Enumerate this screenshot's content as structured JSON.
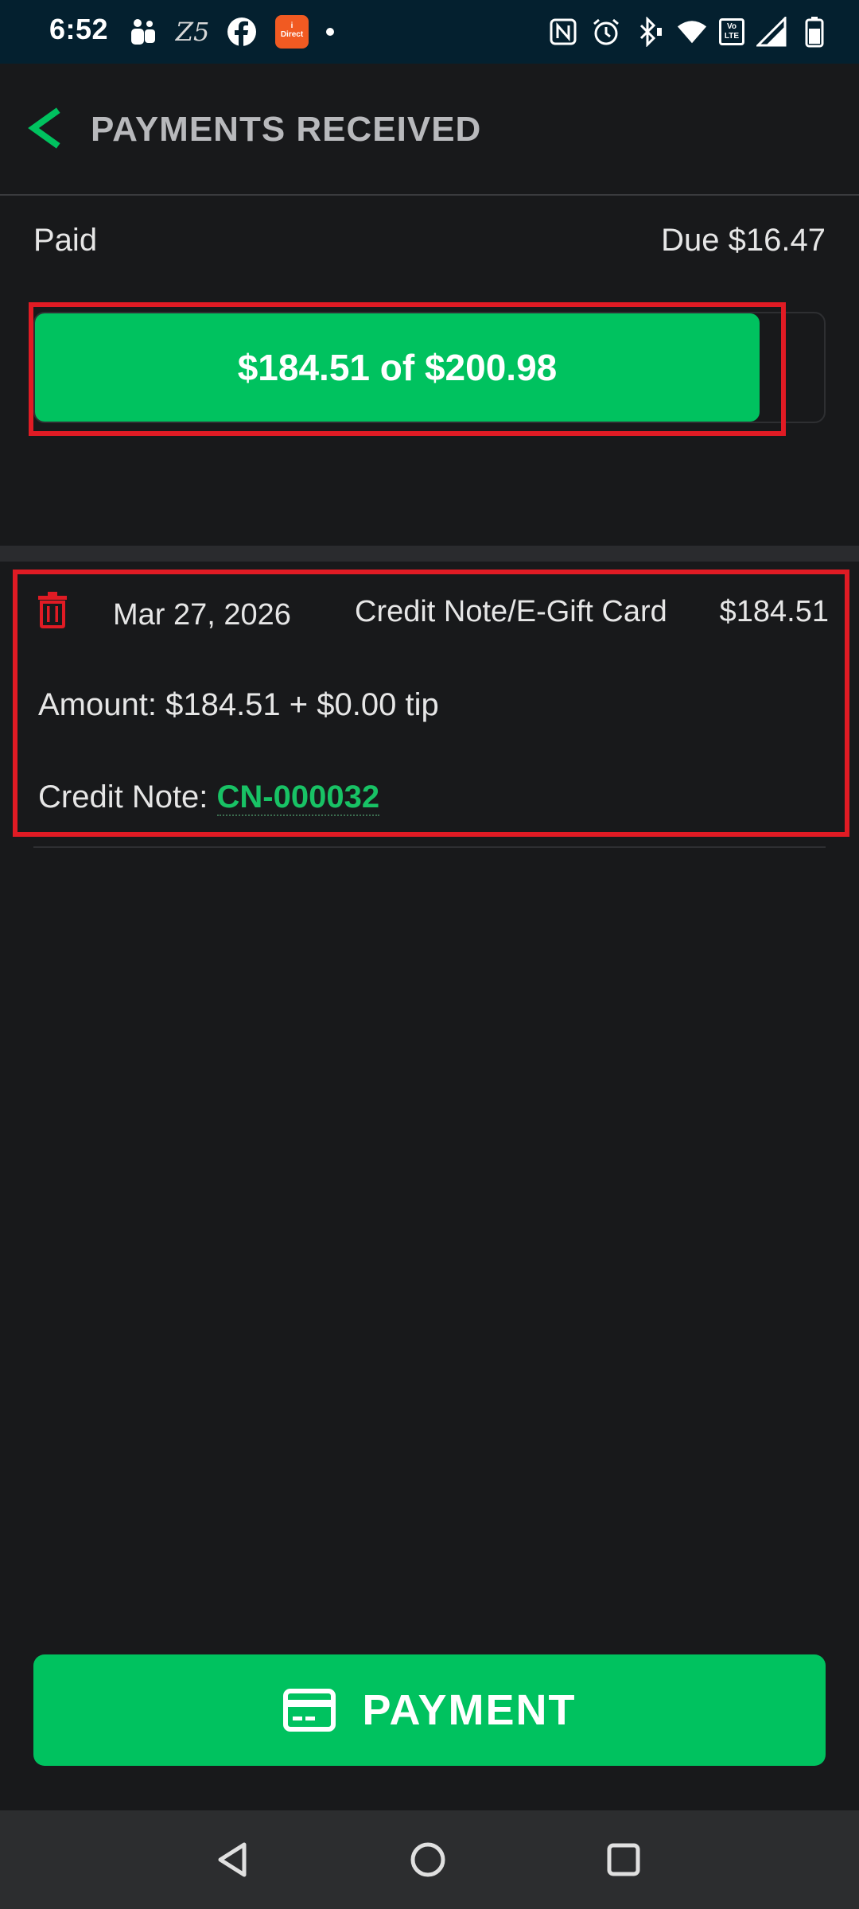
{
  "status_bar": {
    "time": "6:52",
    "left_icons": [
      "teams-icon",
      "zee5-icon",
      "facebook-icon",
      "icici-direct-icon",
      "notification-dot-icon"
    ],
    "zee5_text": "Z5",
    "right_icons": [
      "nfc-icon",
      "alarm-icon",
      "bluetooth-icon",
      "wifi-icon",
      "volte-icon",
      "signal-icon",
      "battery-icon"
    ],
    "volte_text": "Vo LTE"
  },
  "header": {
    "back_icon": "chevron-left-icon",
    "title": "PAYMENTS RECEIVED"
  },
  "summary": {
    "paid_label": "Paid",
    "due_label": "Due $16.47",
    "progress_text": "$184.51 of $200.98",
    "paid_amount": 184.51,
    "total_amount": 200.98,
    "progress_fraction": 0.918
  },
  "payment": {
    "delete_icon": "trash-icon",
    "date": "Mar 27, 2026",
    "method": "Credit Note/E-Gift Card",
    "amount": "$184.51",
    "amount_line": "Amount: $184.51 + $0.00 tip",
    "credit_note_label": "Credit Note: ",
    "credit_note_id": "CN-000032"
  },
  "actions": {
    "payment_label": "PAYMENT",
    "payment_icon": "credit-card-icon"
  },
  "nav": {
    "back": "nav-back-icon",
    "home": "nav-home-icon",
    "recents": "nav-recents-icon"
  },
  "colors": {
    "accent_green": "#00c25f",
    "link_green": "#18c265",
    "highlight_red": "#e01b24",
    "background": "#18191b",
    "status_bar": "#04202f"
  }
}
